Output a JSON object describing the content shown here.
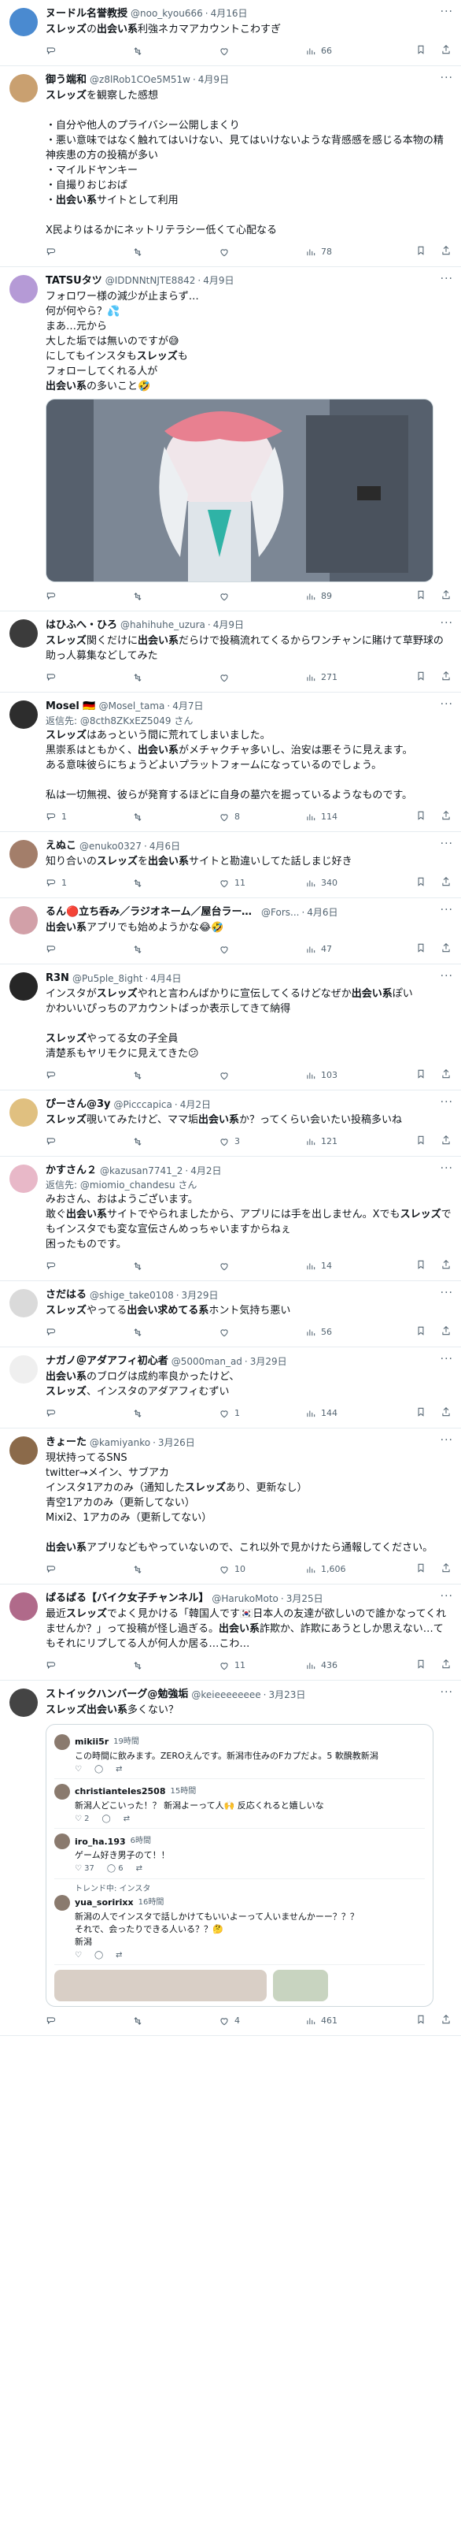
{
  "tweets": [
    {
      "name": "ヌードル名誉教授",
      "handle": "@noo_kyou666",
      "date": "4月16日",
      "reply_to": "",
      "lines": [
        [
          "",
          "スレッズ"
        ],
        [
          "の",
          ""
        ],
        [
          "",
          "出会い系"
        ],
        [
          "利強ネカマアカウントこわすぎ",
          ""
        ]
      ],
      "text": "",
      "counts": {
        "reply": "",
        "retweet": "",
        "like": "",
        "views": "66"
      },
      "avatar": "#4a8ad0"
    },
    {
      "name": "御う端和",
      "handle": "@z8lRob1COe5M51w",
      "date": "4月9日",
      "text": "スレッズを観察した感想\n\n・自分や他人のプライバシー公開しまくり\n・悪い意味ではなく触れてはいけない、見てはいけないような背感感を感じる本物の精神疾患の方の投稿が多い\n・マイルドヤンキー\n・自撮りおじおば\n・出会い系サイトとして利用\n\nX民よりはるかにネットリテラシー低くて心配なる",
      "counts": {
        "reply": "",
        "retweet": "",
        "like": "",
        "views": "78"
      },
      "avatar": "#c9a070"
    },
    {
      "name": "TATSUタツ",
      "handle": "@IDDNNtNJTE8842",
      "date": "4月9日",
      "text": "フォロワー様の減少が止まらず…\n何が何やら？💦\nまあ…元から\n大した垢では無いのですが😅\nにしてもインスタもスレッズも\nフォローしてくれる人が\n出会い系の多いこと🤣",
      "counts": {
        "reply": "",
        "retweet": "",
        "like": "",
        "views": "89"
      },
      "avatar": "#b59ad6"
    },
    {
      "name": "はひふへ・ひろ",
      "handle": "@hahihuhe_uzura",
      "date": "4月9日",
      "text": "スレッズ関くだけに出会い系だらけで投稿流れてくるからワンチャンに賭けて草野球の助っ人募集などしてみた",
      "counts": {
        "reply": "",
        "retweet": "",
        "like": "",
        "views": "271"
      },
      "avatar": "#3b3b3b"
    },
    {
      "name": "Mosel 🇩🇪",
      "handle": "@Mosel_tama",
      "date": "4月7日",
      "reply": "返信先: @8cth8ZKxEZ5049 さん",
      "text": "スレッズはあっという間に荒れてしまいました。\n黒崇系はともかく、出会い系がメチャクチャ多いし、治安は悪そうに見えます。\nある意味彼らにちょうどよいプラットフォームになっているのでしょう。\n\n私は一切無視、彼らが発育するほどに自身の墓穴を掘っているようなものです。",
      "counts": {
        "reply": "1",
        "retweet": "",
        "like": "8",
        "views": "114"
      },
      "avatar": "#2d2d2d"
    },
    {
      "name": "えぬこ",
      "handle": "@enuko0327",
      "date": "4月6日",
      "text": "知り合いのスレッズを出会い系サイトと勘違いしてた話しまじ好き",
      "counts": {
        "reply": "1",
        "retweet": "",
        "like": "11",
        "views": "340"
      },
      "avatar": "#a37e6a"
    },
    {
      "name": "るん🔴立ち呑み／ラジオネーム／屋台ラーメン／南...",
      "handle": "@Fors...",
      "date": "4月6日",
      "text": "出会い系アプリでも始めようかな😂🤣",
      "counts": {
        "reply": "",
        "retweet": "",
        "like": "",
        "views": "47"
      },
      "avatar": "#d2a0a8"
    },
    {
      "name": "R3N",
      "handle": "@Pu5ple_8ight",
      "date": "4月4日",
      "text": "インスタがスレッズやれと言わんばかりに宣伝してくるけどなぜか出会い系ぽい\nかわいいぴっちのアカウントばっか表示してきて納得\n\nスレッズやってる女の子全員\n清楚系もヤリモクに見えてきた😕",
      "counts": {
        "reply": "",
        "retweet": "",
        "like": "",
        "views": "103"
      },
      "avatar": "#262626"
    },
    {
      "name": "ぴーさん@3y",
      "handle": "@Picccapica",
      "date": "4月2日",
      "text": "スレッズ覗いてみたけど、ママ垢出会い系か？ってくらい会いたい投稿多いね",
      "counts": {
        "reply": "",
        "retweet": "",
        "like": "3",
        "views": "121"
      },
      "avatar": "#e0c080"
    },
    {
      "name": "かすさん２",
      "handle": "@kazusan7741_2",
      "date": "4月2日",
      "reply": "返信先: @miomio_chandesu さん",
      "text": "みおさん、おはようございます。\n敢ぐ出会い系サイトでやられましたから、アプリには手を出しません。Xでもスレッズでもインスタでも変な宣伝さんめっちゃいますからねぇ\n困ったものです。",
      "counts": {
        "reply": "",
        "retweet": "",
        "like": "",
        "views": "14"
      },
      "avatar": "#e8b8c8"
    },
    {
      "name": "さだはる",
      "handle": "@shige_take0108",
      "date": "3月29日",
      "text": "スレッズやってる出会い求めてる系ホント気持ち悪い",
      "counts": {
        "reply": "",
        "retweet": "",
        "like": "",
        "views": "56"
      },
      "avatar": "#dadada"
    },
    {
      "name": "ナガノ＠アダアフィ初心者",
      "handle": "@5000man_ad",
      "date": "3月29日",
      "text": "出会い系のブログは成約率良かったけど、\nスレッズ、インスタのアダアフィむずい",
      "counts": {
        "reply": "",
        "retweet": "",
        "like": "1",
        "views": "144"
      },
      "avatar": "#efefef"
    },
    {
      "name": "きょーた",
      "handle": "@kamiyanko",
      "date": "3月26日",
      "text": "現状持ってるSNS\ntwitter→メイン、サブアカ\nインスタ1アカのみ（通知したスレッズあり、更新なし）\n青空1アカのみ（更新してない）\nMixi2、1アカのみ（更新してない）\n\n出会い系アプリなどもやっていないので、これ以外で見かけたら通報してください。",
      "counts": {
        "reply": "",
        "retweet": "",
        "like": "10",
        "views": "1,606"
      },
      "avatar": "#8b6a4a"
    },
    {
      "name": "ぱるぱる【バイク女子チャンネル】",
      "handle": "@HarukoMoto",
      "date": "3月25日",
      "text": "最近スレッズでよく見かける「韓国人です🇰🇷日本人の友達が欲しいので誰かなってくれませんか？」って投稿が怪し過ぎる。出会い系詐欺か、詐欺にあうとしか思えない…てもそれにリプしてる人が何人か居る…こわ…",
      "counts": {
        "reply": "",
        "retweet": "",
        "like": "11",
        "views": "436"
      },
      "avatar": "#b06a8a"
    },
    {
      "name": "ストイックハンバーグ@勉強垢",
      "handle": "@keieeeeeeee",
      "date": "3月23日",
      "text": "スレッズ出会い系多くない？",
      "counts": {
        "reply": "",
        "retweet": "",
        "like": "4",
        "views": "461"
      },
      "avatar": "#444444"
    }
  ],
  "quote": {
    "items": [
      {
        "name": "mikii5r",
        "time": "19時間",
        "text": "この時間に飲みます。ZEROえんです。新潟市住みのFカプだよ。5 軟醗教新潟",
        "acts": [
          "",
          "",
          ""
        ]
      },
      {
        "name": "christianteles2508",
        "time": "15時間",
        "text": "新潟人どこいった！？ 新潟よーって人🙌 反応くれると嬉しいな",
        "acts": [
          "2",
          "",
          ""
        ]
      },
      {
        "name": "iro_ha.193",
        "time": "6時間",
        "text": "ゲーム好き男子のて！！",
        "acts": [
          "37",
          "6",
          ""
        ]
      },
      {
        "name": "yua_soririxx",
        "time": "16時間",
        "text": "新潟の人でインスタで話しかけてもいいよーって人いませんかーー？？？\nそれで、会ったりできる人いる？？🤔\n新潟",
        "acts": [
          "",
          "",
          ""
        ],
        "trend": "トレンド中: インスタ"
      }
    ]
  }
}
